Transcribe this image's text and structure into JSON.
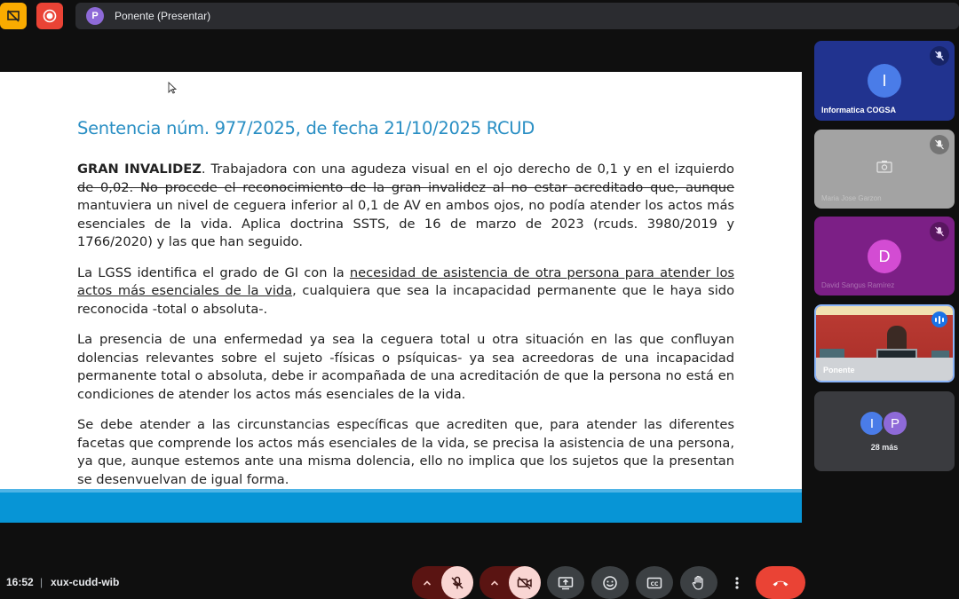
{
  "topbar": {
    "presenter_initial": "P",
    "presenter_label": "Ponente (Presentar)"
  },
  "slide": {
    "title": "Sentencia núm. 977/2025, de fecha 21/10/2025 RCUD",
    "p1": {
      "bold": "GRAN INVALIDEZ",
      "line1_rest": ". Trabajadora con una agudeza visual en el ojo derecho de 0,1 y en el izquierdo",
      "struck": "de 0,02. No procede el reconocimiento de la gran invalidez al no estar acreditado que, aunque",
      "rest": "mantuviera un nivel de ceguera inferior al 0,1 de AV en ambos ojos, no podía atender los actos más esenciales de la vida. Aplica doctrina SSTS, de 16 de marzo de 2023 (rcuds. 3980/2019 y 1766/2020) y las que han seguido."
    },
    "p2": {
      "before": "La LGSS identifica el grado de GI con la ",
      "underlined": "necesidad de asistencia de otra persona para atender los actos más esenciales de la vida",
      "after": ", cualquiera que sea la incapacidad permanente que le haya sido reconocida -total o absoluta-."
    },
    "p3": "La presencia de una enfermedad ya sea la ceguera total u otra situación en las que confluyan dolencias relevantes sobre el sujeto -físicas o psíquicas- ya sea acreedoras de una incapacidad permanente total o absoluta, debe ir acompañada de una acreditación de que la persona no está en condiciones de atender los actos más esenciales de la vida.",
    "p4": "Se debe atender a las circunstancias específicas que acrediten que, para atender las diferentes facetas que comprende los actos más esenciales de la vida, se precisa la asistencia de una persona, ya que, aunque estemos ante una misma dolencia, ello no implica que los sujetos que la presentan se desenvuelvan de igual forma."
  },
  "participants": [
    {
      "name": "Informatica COGSA",
      "initial": "I",
      "avatar_color": "#4a7ce8"
    },
    {
      "name": "Maria Jose Garzon"
    },
    {
      "name": "David Sangus Ramírez",
      "initial": "D",
      "avatar_color": "#d34cd3"
    },
    {
      "name": "Ponente"
    }
  ],
  "more": {
    "initials": [
      "I",
      "P"
    ],
    "colors": [
      "#4a7ce8",
      "#8e6ad8"
    ],
    "label": "28 más"
  },
  "bottombar": {
    "time": "16:52",
    "separator": "|",
    "meeting_code": "xux-cudd-wib"
  },
  "colors": {
    "accent_title": "#2a8fc4",
    "footer_blue": "#0795d6",
    "hangup_red": "#ea4335"
  }
}
